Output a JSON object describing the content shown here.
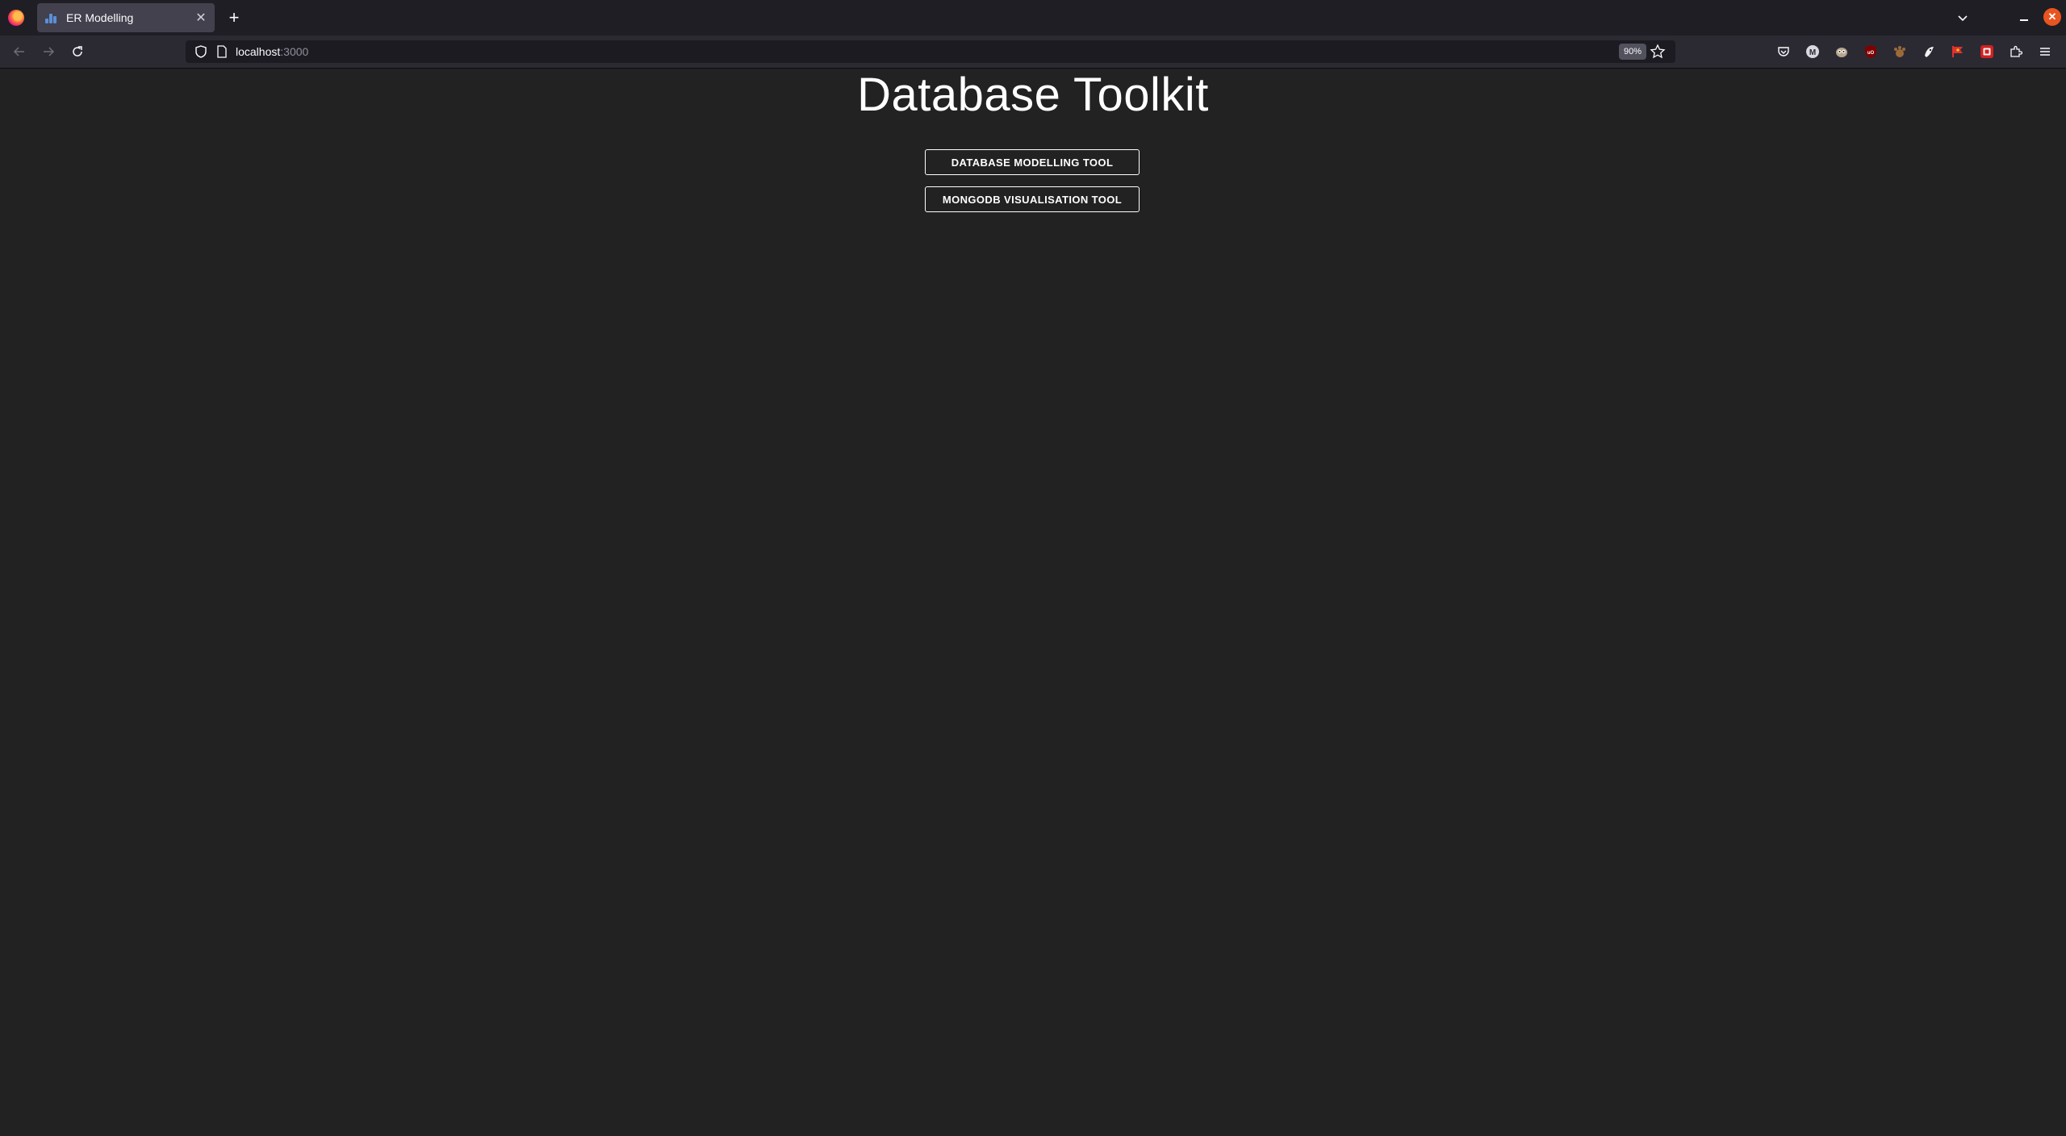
{
  "browser": {
    "tab": {
      "title": "ER Modelling"
    },
    "url": {
      "host": "localhost",
      "port": ":3000"
    },
    "zoom": "90%"
  },
  "page": {
    "title": "Database Toolkit",
    "buttons": [
      {
        "label": "DATABASE MODELLING TOOL"
      },
      {
        "label": "MONGODB VISUALISATION TOOL"
      }
    ]
  },
  "colors": {
    "page_background": "#222222",
    "toolbar": "#2b2a33",
    "button_border": "#ffffff"
  },
  "icons": {
    "toolbar_extensions": [
      "pocket-icon",
      "m-extension-icon",
      "owl-extension-icon",
      "ublock-icon",
      "paw-extension-icon",
      "squid-extension-icon",
      "flag-extension-icon",
      "red-square-extension-icon",
      "extensions-puzzle-icon"
    ]
  }
}
